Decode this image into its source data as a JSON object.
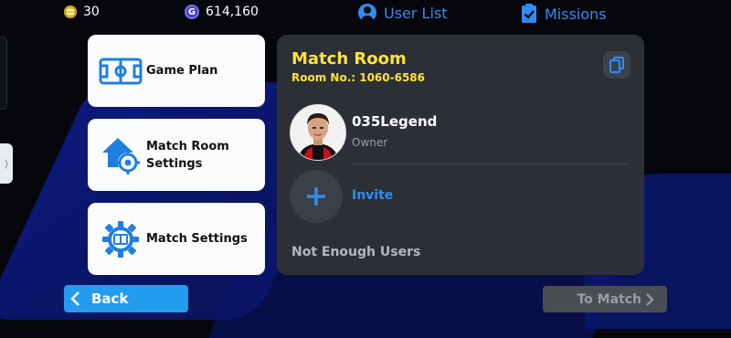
{
  "topbar": {
    "coins_value": "30",
    "gp_icon_letter": "G",
    "gp_value": "614,160",
    "user_list_label": "User List",
    "missions_label": "Missions"
  },
  "left_tab_glyph": "⟩",
  "menu": {
    "items": [
      {
        "label": "Game Plan",
        "icon": "formation-board-icon"
      },
      {
        "label_line1": "Match Room",
        "label_line2": "Settings",
        "icon": "room-settings-icon"
      },
      {
        "label": "Match Settings",
        "icon": "gear-settings-icon"
      }
    ]
  },
  "room": {
    "title": "Match Room",
    "room_number": "Room No.: 1060-6586",
    "owner_name": "035Legend",
    "owner_role": "Owner",
    "invite_label": "Invite",
    "status": "Not Enough Users"
  },
  "bottom": {
    "back_label": "Back",
    "to_match_label": "To Match"
  },
  "colors": {
    "accent_blue": "#2f8ef0",
    "title_yellow": "#ffe338",
    "back_button": "#239cf0"
  }
}
